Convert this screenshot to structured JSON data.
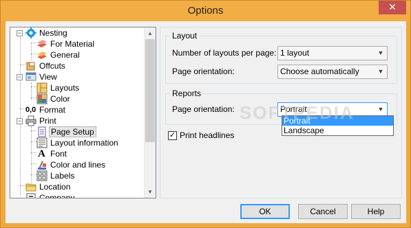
{
  "window": {
    "title": "Options",
    "close_glyph": "✕"
  },
  "tree": {
    "items": [
      {
        "label": "Nesting",
        "icon": "gear-icon"
      },
      {
        "label": "For Material",
        "icon": "material-icon"
      },
      {
        "label": "General",
        "icon": "material-icon"
      },
      {
        "label": "Offcuts",
        "icon": "offcuts-icon"
      },
      {
        "label": "View",
        "icon": "view-icon"
      },
      {
        "label": "Layouts",
        "icon": "layouts-icon"
      },
      {
        "label": "Color",
        "icon": "color-icon"
      },
      {
        "label": "Format",
        "icon": "format-icon",
        "icon_text": "0,0"
      },
      {
        "label": "Print",
        "icon": "printer-icon"
      },
      {
        "label": "Page Setup",
        "icon": "page-setup-icon"
      },
      {
        "label": "Layout information",
        "icon": "layout-info-icon"
      },
      {
        "label": "Font",
        "icon": "font-icon",
        "icon_text": "A"
      },
      {
        "label": "Color and lines",
        "icon": "color-lines-icon"
      },
      {
        "label": "Labels",
        "icon": "labels-icon"
      },
      {
        "label": "Location",
        "icon": "folder-icon"
      },
      {
        "label": "Company",
        "icon": "company-icon"
      }
    ],
    "expanders": {
      "collapse": "−"
    },
    "scroll": {
      "up": "▲",
      "down": "▼"
    }
  },
  "layout_group": {
    "title": "Layout",
    "layouts_label": "Number of layouts per page:",
    "layouts_value": "1 layout",
    "orientation_label": "Page orientation:",
    "orientation_value": "Choose automatically"
  },
  "reports_group": {
    "title": "Reports",
    "orientation_label": "Page orientation:",
    "orientation_value": "Portrait",
    "options": [
      "Portrait",
      "Landscape"
    ]
  },
  "print_headlines": {
    "label": "Print headlines",
    "checked": true,
    "mark": "✓"
  },
  "watermark": "SOFTPEDIA",
  "dropdown_arrow": "▼",
  "buttons": {
    "ok": "OK",
    "cancel": "Cancel",
    "help": "Help"
  }
}
